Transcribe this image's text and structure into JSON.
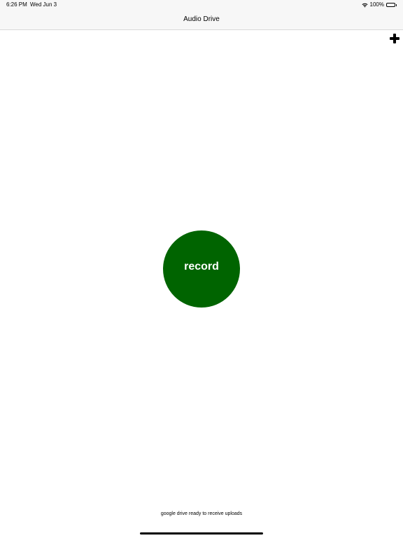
{
  "status_bar": {
    "time": "6:26 PM",
    "date": "Wed Jun 3",
    "battery_percent": "100%",
    "battery_level": 1.0,
    "icons": [
      "wifi-icon",
      "battery-icon"
    ]
  },
  "nav": {
    "title": "Audio Drive",
    "add_icon": "plus-icon"
  },
  "record_button": {
    "label": "record",
    "color": "#006400"
  },
  "footer": {
    "status_message": "google drive ready to receive uploads"
  }
}
